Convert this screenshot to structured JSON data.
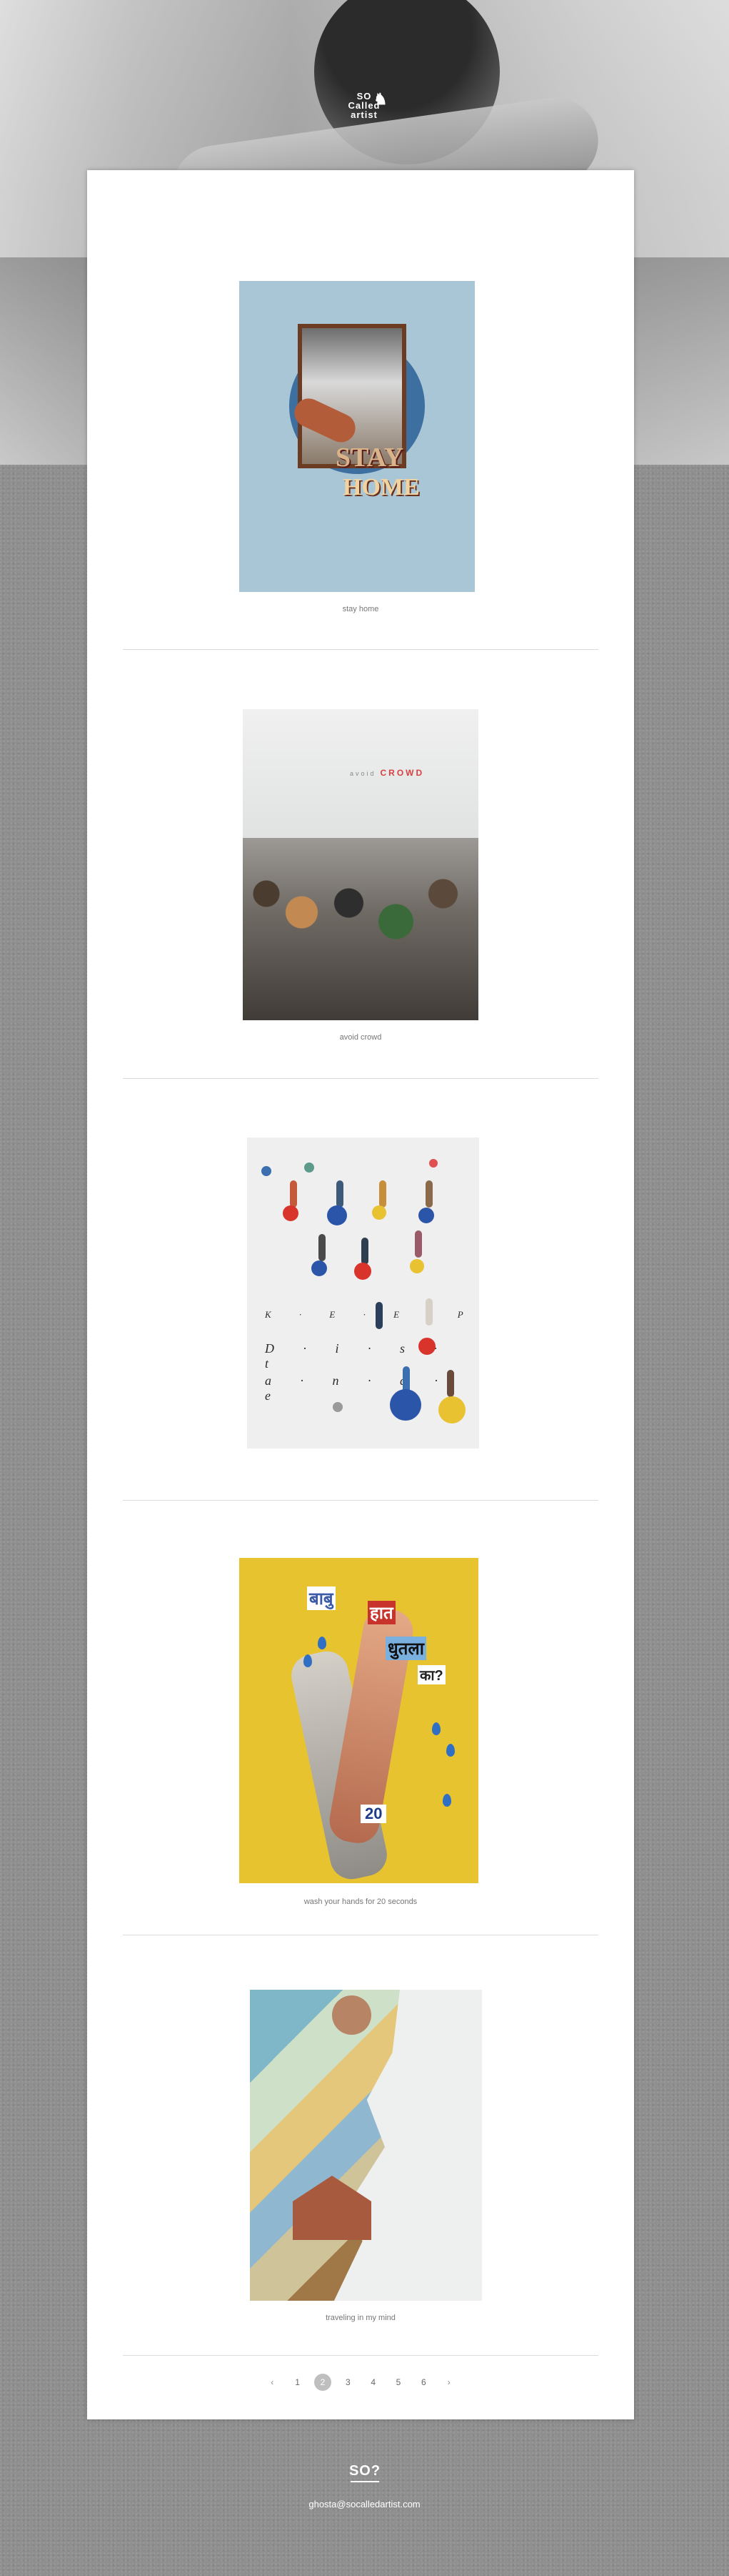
{
  "brand": {
    "logo_text": "SO\nCalled\nartist",
    "logo_short": "SO?",
    "email": "ghosta@socalledartist.com"
  },
  "posts": [
    {
      "caption": "stay home",
      "art_words": [
        "STAY",
        "HOME"
      ]
    },
    {
      "caption": "avoid crowd",
      "art_words": [
        "avoid",
        "CROWD"
      ]
    },
    {
      "caption": "",
      "art_words": [
        "K · E · E · P",
        "D · i · s · t",
        "a · n · c · e"
      ]
    },
    {
      "caption": "wash your hands for 20 seconds",
      "art_words": [
        "बाबु",
        "हात",
        "धुतला",
        "का?",
        "20"
      ]
    },
    {
      "caption": "traveling in my mind",
      "art_words": []
    }
  ],
  "pagination": {
    "prev": "‹",
    "next": "›",
    "pages": [
      "1",
      "2",
      "3",
      "4",
      "5",
      "6"
    ],
    "current": 2
  }
}
